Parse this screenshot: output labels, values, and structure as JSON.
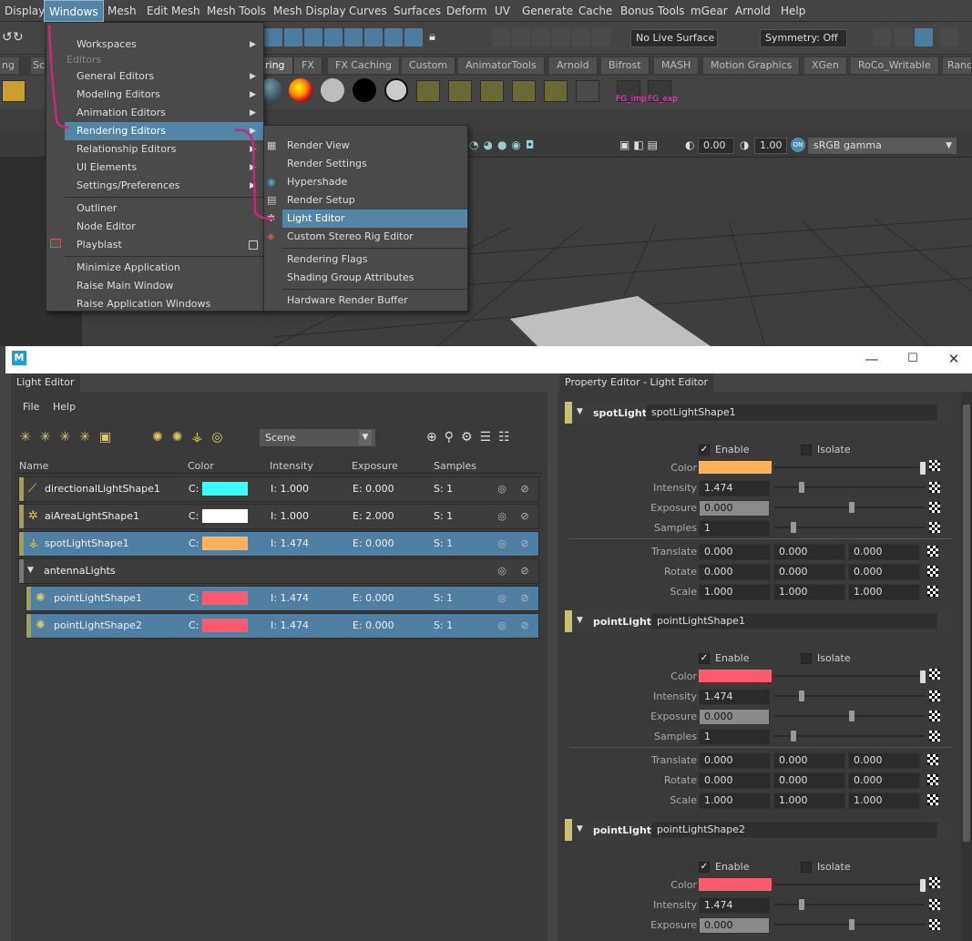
{
  "menubar": [
    "Display",
    "Windows",
    "Mesh",
    "Edit Mesh",
    "Mesh Tools",
    "Mesh Display",
    "Curves",
    "Surfaces",
    "Deform",
    "UV",
    "Generate",
    "Cache",
    "Bonus Tools",
    "mGear",
    "Arnold",
    "Help"
  ],
  "status": {
    "live_surface": "No Live Surface",
    "symmetry": "Symmetry: Off"
  },
  "shelf_tabs": [
    "ring",
    "FX",
    "FX Caching",
    "Custom",
    "AnimatorTools",
    "Arnold",
    "Bifrost",
    "MASH",
    "Motion Graphics",
    "XGen",
    "RoCo_Writable",
    "Rand"
  ],
  "shelf_left_tabs": [
    "ng",
    "Sc"
  ],
  "shelf_labels": {
    "fg_imp": "FG_imp",
    "fg_exp": "FG_exp"
  },
  "viewport": {
    "val1": "0.00",
    "val2": "1.00",
    "colorspace": "sRGB gamma"
  },
  "windows_menu": {
    "items": [
      "Workspaces",
      "Editors",
      "General Editors",
      "Modeling Editors",
      "Animation Editors",
      "Rendering Editors",
      "Relationship Editors",
      "UI Elements",
      "Settings/Preferences",
      "Outliner",
      "Node Editor",
      "Playblast",
      "Minimize Application",
      "Raise Main Window",
      "Raise Application Windows"
    ]
  },
  "rendering_menu": {
    "items": [
      "Render View",
      "Render Settings",
      "Hypershade",
      "Render Setup",
      "Light Editor",
      "Custom Stereo Rig Editor",
      "Rendering Flags",
      "Shading Group Attributes",
      "Hardware Render Buffer"
    ]
  },
  "light_editor": {
    "tab": "Light Editor",
    "menu": [
      "File",
      "Help"
    ],
    "filter": "Scene",
    "columns": [
      "Name",
      "Color",
      "Intensity",
      "Exposure",
      "Samples"
    ],
    "rows": [
      {
        "name": "directionalLightShape1",
        "c": "C:",
        "color": "#38ffff",
        "i": "I: 1.000",
        "e": "E: 0.000",
        "s": "S: 1"
      },
      {
        "name": "aiAreaLightShape1",
        "c": "C:",
        "color": "#ffffff",
        "i": "I: 1.000",
        "e": "E: 2.000",
        "s": "S: 1"
      },
      {
        "name": "spotLightShape1",
        "c": "C:",
        "color": "#ffb25a",
        "i": "I: 1.474",
        "e": "E: 0.000",
        "s": "S: 1"
      },
      {
        "name": "antennaLights"
      },
      {
        "name": "pointLightShape1",
        "c": "C:",
        "color": "#ff5a6e",
        "i": "I: 1.474",
        "e": "E: 0.000",
        "s": "S: 1"
      },
      {
        "name": "pointLightShape2",
        "c": "C:",
        "color": "#ff5a6e",
        "i": "I: 1.474",
        "e": "E: 0.000",
        "s": "S: 1"
      }
    ]
  },
  "property_editor": {
    "tab": "Property Editor - Light Editor",
    "labels": {
      "enable": "Enable",
      "isolate": "Isolate",
      "color": "Color",
      "intensity": "Intensity",
      "exposure": "Exposure",
      "samples": "Samples",
      "translate": "Translate",
      "rotate": "Rotate",
      "scale": "Scale"
    },
    "sections": [
      {
        "type": "spotLight",
        "name": "spotLightShape1",
        "color": "#ffb25a",
        "intensity": "1.474",
        "exposure": "0.000",
        "samples": "1",
        "translate": [
          "0.000",
          "0.000",
          "0.000"
        ],
        "rotate": [
          "0.000",
          "0.000",
          "0.000"
        ],
        "scale": [
          "1.000",
          "1.000",
          "1.000"
        ]
      },
      {
        "type": "pointLight",
        "name": "pointLightShape1",
        "color": "#ff5a6e",
        "intensity": "1.474",
        "exposure": "0.000",
        "samples": "1",
        "translate": [
          "0.000",
          "0.000",
          "0.000"
        ],
        "rotate": [
          "0.000",
          "0.000",
          "0.000"
        ],
        "scale": [
          "1.000",
          "1.000",
          "1.000"
        ]
      },
      {
        "type": "pointLight",
        "name": "pointLightShape2",
        "color": "#ff5a6e",
        "intensity": "1.474",
        "exposure": "0.000"
      }
    ]
  }
}
